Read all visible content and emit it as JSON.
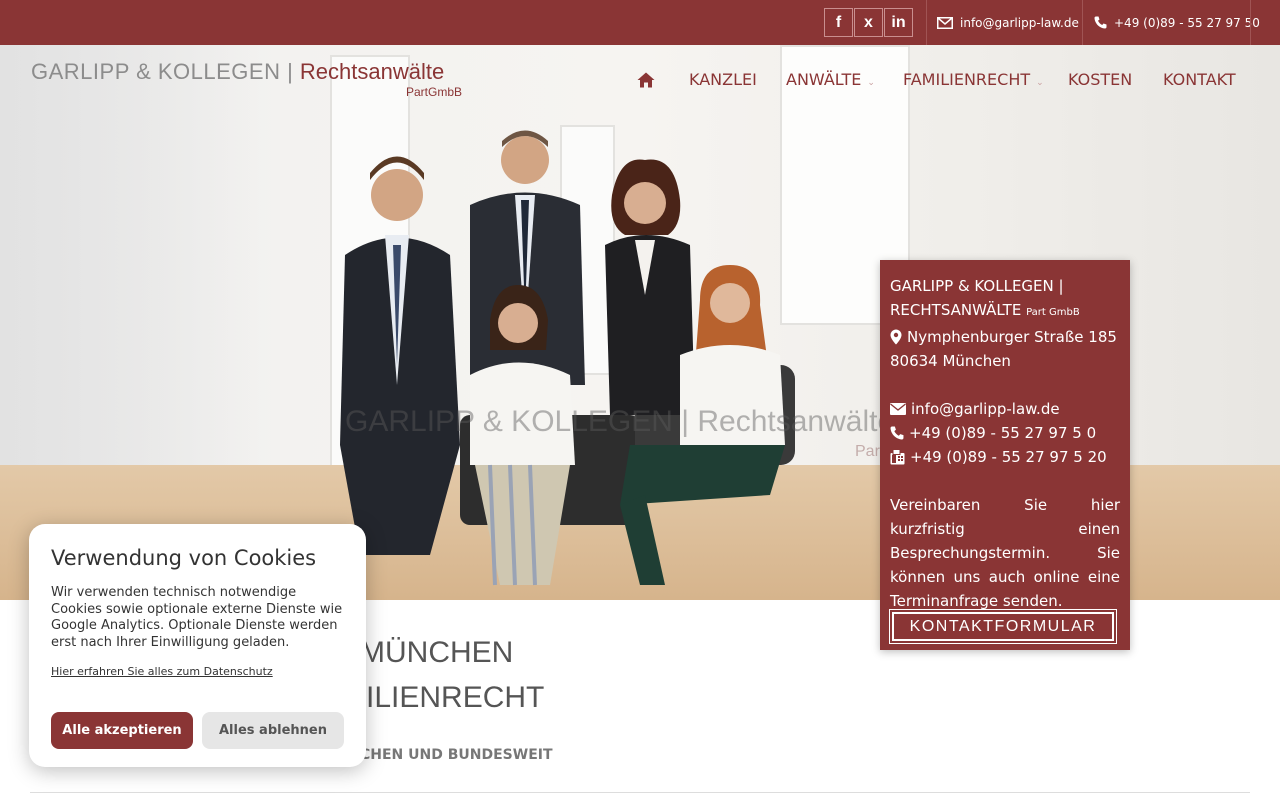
{
  "topbar": {
    "social": {
      "facebook": "f",
      "xing": "x",
      "linkedin": "in"
    },
    "email": "info@garlipp-law.de",
    "phone": "+49 (0)89 - 55 27 97 50"
  },
  "logo": {
    "main": "GARLIPP & KOLLEGEN | ",
    "red": "Rechtsanwälte",
    "sub": "PartGmbB"
  },
  "nav": {
    "home_icon": "home-icon",
    "items": [
      {
        "label": "KANZLEI",
        "dropdown": false
      },
      {
        "label": "ANWÄLTE",
        "dropdown": true
      },
      {
        "label": "FAMILIENRECHT",
        "dropdown": true
      },
      {
        "label": "KOSTEN",
        "dropdown": false
      },
      {
        "label": "KONTAKT",
        "dropdown": false
      }
    ]
  },
  "hero": {
    "watermark_main": "GARLIPP & KOLLEGEN | Rechtsanwälte",
    "watermark_sub": "PartGmbB"
  },
  "info_box": {
    "firm_line1": "GARLIPP & KOLLEGEN |",
    "firm_line2": "RECHTSANWÄLTE",
    "firm_suffix": "Part GmbB",
    "street": "Nymphenburger Straße 185",
    "city": "80634 München",
    "email": "info@garlipp-law.de",
    "phone": "+49 (0)89 - 55 27 97 5 0",
    "fax": "+49 (0)89 - 55 27 97 5 20",
    "text": "Vereinbaren Sie hier kurzfristig einen Besprechungstermin. Sie können uns auch online eine Terminanfrage senden.",
    "button": "KONTAKTFORMULAR"
  },
  "content": {
    "heading_line1": "MÜNCHEN",
    "heading_line2": "ILIENRECHT",
    "subheading": "CHEN UND BUNDESWEIT"
  },
  "cookie": {
    "title": "Verwendung von Cookies",
    "text": "Wir verwenden technisch notwendige Cookies sowie optionale externe Dienste wie Google Analytics. Optionale Dienste werden erst nach Ihrer Einwilligung geladen.",
    "privacy_link": "Hier erfahren Sie alles zum Datenschutz",
    "accept": "Alle akzeptieren",
    "reject": "Alles ablehnen"
  },
  "colors": {
    "brand": "#8a3535",
    "text": "#333333"
  }
}
